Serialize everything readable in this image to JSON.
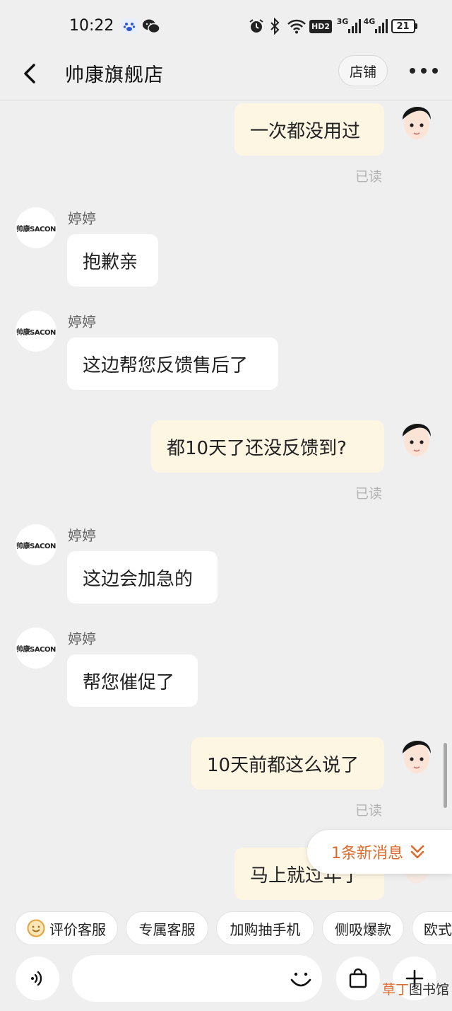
{
  "status_bar": {
    "time": "10:22",
    "network_3g": "3G",
    "network_4g": "4G",
    "battery": "21",
    "hd_badge": "HD2"
  },
  "header": {
    "title": "帅康旗舰店",
    "shop_button": "店铺"
  },
  "shop_logo_text": "帅康SACON",
  "messages": [
    {
      "side": "me",
      "text": "一次都没用过",
      "status": "已读"
    },
    {
      "side": "them",
      "sender": "婷婷",
      "text": "抱歉亲"
    },
    {
      "side": "them",
      "sender": "婷婷",
      "text": "这边帮您反馈售后了"
    },
    {
      "side": "me",
      "text": "都10天了还没反馈到?",
      "status": "已读"
    },
    {
      "side": "them",
      "sender": "婷婷",
      "text": "这边会加急的"
    },
    {
      "side": "them",
      "sender": "婷婷",
      "text": "帮您催促了"
    },
    {
      "side": "me",
      "text": "10天前都这么说了",
      "status": "已读"
    },
    {
      "side": "me",
      "text": "马上就过年了"
    }
  ],
  "new_message_banner": "1条新消息",
  "quick_replies": [
    "评价客服",
    "专属客服",
    "加购抽手机",
    "侧吸爆款",
    "欧式"
  ],
  "input": {
    "placeholder": ""
  },
  "watermark": {
    "accent": "草丁",
    "rest": "图书馆"
  },
  "colors": {
    "my_bubble": "#fdf6e3",
    "their_bubble": "#ffffff",
    "accent": "#e06a2a",
    "background": "#efefef"
  }
}
